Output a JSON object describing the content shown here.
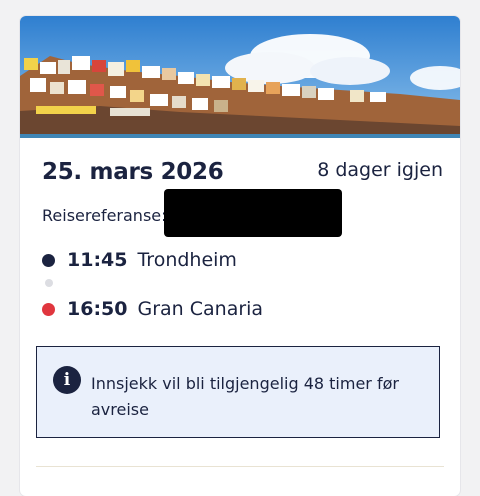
{
  "trip": {
    "date": "25. mars 2026",
    "days_left": "8 dager igjen",
    "reference_label": "Reisereferanse:",
    "departure": {
      "time": "11:45",
      "place": "Trondheim"
    },
    "arrival": {
      "time": "16:50",
      "place": "Gran Canaria"
    }
  },
  "notice": {
    "icon": "info-icon",
    "text": "Innsjekk vil bli tilgjengelig 48 timer før avreise"
  },
  "colors": {
    "primary_text": "#1b2340",
    "departure_dot": "#1b2340",
    "arrival_dot": "#e0363e",
    "notice_bg": "#eaf0fb"
  }
}
